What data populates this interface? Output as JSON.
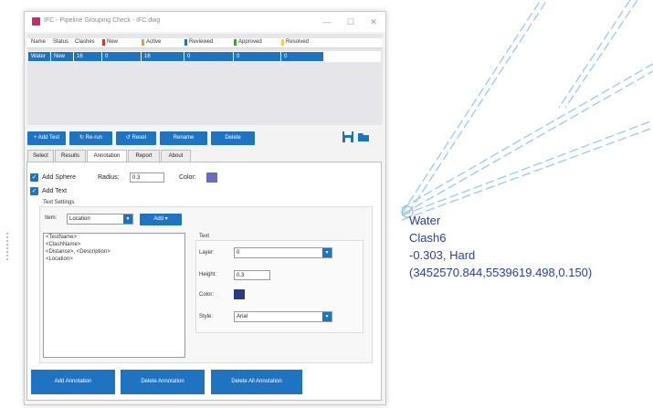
{
  "window": {
    "title": "IFC - Pipeline Grouping Check - IFC.dwg",
    "controls": {
      "minimize": "—",
      "maximize": "☐",
      "close": "✕"
    }
  },
  "grid": {
    "headers": [
      "Name",
      "Status",
      "Clashes",
      "New",
      "Active",
      "Reviewed",
      "Approved",
      "Resolved"
    ],
    "header_swatches": {
      "New": "#e0302a",
      "Active": "#f0a020",
      "Reviewed": "#1f74c2",
      "Approved": "#2eaa3a",
      "Resolved": "#f3d23a"
    },
    "row": [
      "Water",
      "New",
      "16",
      "0",
      "16",
      "0",
      "0",
      "0"
    ]
  },
  "toolbar": {
    "add_test": "+ Add Test",
    "re_run": "↻ Re-run",
    "reset": "↺ Reset",
    "rename": "Rename",
    "delete": "Delete"
  },
  "tabs": [
    "Select",
    "Results",
    "Annotation",
    "Report",
    "About"
  ],
  "active_tab": "Annotation",
  "annotation": {
    "add_sphere_label": "Add Sphere",
    "radius_label": "Radius:",
    "radius_value": "0.3",
    "color_label": "Color:",
    "sphere_color": "#6a6ac8",
    "add_text_label": "Add Text",
    "text_settings_label": "Text Settings",
    "item_label": "Item:",
    "item_value": "Location",
    "add_button": "Add",
    "template_lines": [
      "<TestName>",
      "<ClashName>",
      "<Distance>, <Description>",
      "<Location>"
    ],
    "text_group_label": "Text",
    "layer_label": "Layer:",
    "layer_value": "0",
    "height_label": "Height:",
    "height_value": "0.3",
    "text_color_label": "Color:",
    "text_color": "#2a3a8a",
    "style_label": "Style:",
    "style_value": "Arial"
  },
  "bottom_buttons": {
    "add_annotation": "Add Annotation",
    "delete_annotation": "Delete Annotation",
    "delete_all_annotation": "Delete All Annotation"
  },
  "canvas_annotation": {
    "lines": [
      "Water",
      "Clash6",
      "-0.303, Hard",
      "(3452570.844,5539619.498,0.150)"
    ],
    "color": "#2a3aa8"
  },
  "colors": {
    "accent": "#1f74c2",
    "pipe": "#9ac8ee"
  }
}
